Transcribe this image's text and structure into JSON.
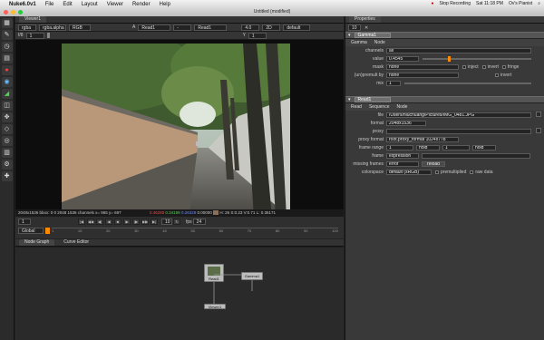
{
  "menubar": {
    "app": "Nuke6.0v1",
    "items": [
      "File",
      "Edit",
      "Layout",
      "Viewer",
      "Render",
      "Help"
    ],
    "recording": "Stop Recording",
    "time": "Sat 11:18 PM",
    "user": "Ov's Pianist"
  },
  "window": {
    "title": "Untitled (modified)"
  },
  "viewer": {
    "tab": "Viewer1",
    "channels": "rgba",
    "channel_alpha": "rgba.alpha",
    "colorspace": "RGB",
    "input_a": "A",
    "input_a_node": "Read1",
    "input_b_node": "Read1",
    "mode": "-",
    "gain": "4.0",
    "lut_mode": "2D",
    "display_lut": "default",
    "frame_label": "f/8",
    "frame": "1",
    "y_field": "Y",
    "y_val": "1",
    "res_label": "2048x1536",
    "info": {
      "text": "2048x1536 bbox: 0 0 2048 1536 channels x= 965 y= 697",
      "r": "0.46288",
      "g": "0.34199",
      "b": "0.26329",
      "a": "0.00000",
      "tail": "H: 26 S:0.23 V:0.71  L: 0.36171"
    },
    "timeline": {
      "fps_label": "fps",
      "fps": "24",
      "step": "10",
      "colorspace": "Global",
      "frame_start": "1",
      "ticks": [
        "1",
        "10",
        "20",
        "30",
        "40",
        "50",
        "60",
        "70",
        "80",
        "90",
        "100"
      ]
    }
  },
  "nodegraph": {
    "tabs": [
      "Node Graph",
      "Curve Editor"
    ],
    "nodes": {
      "read": "Read1",
      "gamma": "Gamma1",
      "viewer": "Viewer1"
    }
  },
  "properties": {
    "title": "Properties",
    "count": "10",
    "gamma": {
      "name": "Gamma1",
      "tabs": [
        "Gamma",
        "Node"
      ],
      "channels_label": "channels",
      "channels": "all",
      "value_label": "value",
      "value": "0.4545",
      "mask_label": "mask",
      "mask": "none",
      "inject": "inject",
      "invert": "invert",
      "fringe": "fringe",
      "unpremult_label": "(un)premult by",
      "unpremult": "none",
      "invert2": "invert",
      "mix_label": "mix",
      "mix": "1"
    },
    "read": {
      "name": "Read1",
      "tabs": [
        "Read",
        "Sequence",
        "Node"
      ],
      "file_label": "file",
      "file": "/Users/niuchuang/Pictures/IMG_0481.JPG",
      "format_label": "format",
      "format": "2048x1536",
      "proxy_label": "proxy",
      "proxy": "",
      "proxy_format_label": "proxy format",
      "proxy_format": "root.proxy_format 1024x778",
      "frame_range_label": "frame range",
      "range_start": "1",
      "hold1": "hold",
      "range_end": "1",
      "hold2": "hold",
      "frame_label": "frame",
      "frame_mode": "expression",
      "missing_label": "missing frames",
      "missing": "error",
      "reload": "reload",
      "colorspace_label": "colorspace",
      "colorspace": "default (sRGB)",
      "premultiplied": "premultiplied",
      "raw": "raw data"
    }
  },
  "colors": {
    "accent": "#ff8a00",
    "panel": "#393939"
  }
}
